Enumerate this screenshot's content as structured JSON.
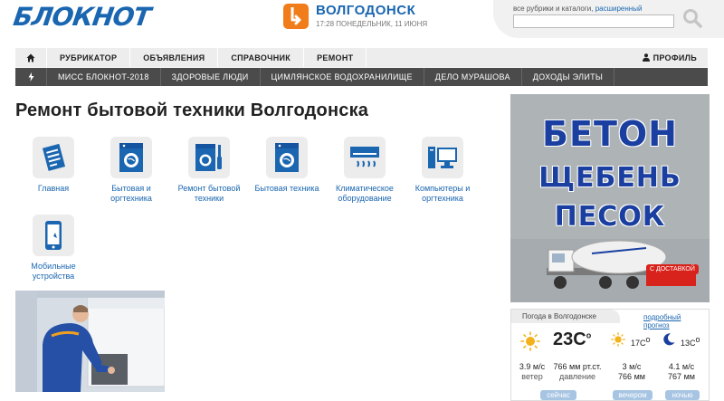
{
  "header": {
    "logo": "БЛОКНОТ",
    "city": "ВОЛГОДОНСК",
    "date": "17:28 ПОНЕДЕЛЬНИК, 11 ИЮНЯ",
    "search_hint": "все рубрики и каталоги,",
    "search_hint_link": "расширенный",
    "search_placeholder": ""
  },
  "menu_main": {
    "items": [
      "РУБРИКАТОР",
      "ОБЪЯВЛЕНИЯ",
      "СПРАВОЧНИК",
      "РЕМОНТ"
    ],
    "profile": "ПРОФИЛЬ"
  },
  "menu_hot": {
    "items": [
      "МИСС БЛОКНОТ-2018",
      "ЗДОРОВЫЕ ЛЮДИ",
      "ЦИМЛЯНСКОЕ ВОДОХРАНИЛИЩЕ",
      "ДЕЛО МУРАШОВА",
      "ДОХОДЫ ЭЛИТЫ"
    ]
  },
  "page": {
    "title": "Ремонт бытовой техники Волгодонска"
  },
  "rubrics": [
    {
      "label": "Главная",
      "icon": "document-icon"
    },
    {
      "label": "Бытовая и оргтехника",
      "icon": "washing-machine-icon"
    },
    {
      "label": "Ремонт бытовой техники",
      "icon": "repair-tools-icon"
    },
    {
      "label": "Бытовая техника",
      "icon": "washing-machine-icon"
    },
    {
      "label": "Климатическое оборудование",
      "icon": "air-conditioner-icon"
    },
    {
      "label": "Компьютеры и оргтехника",
      "icon": "computer-icon"
    },
    {
      "label": "Мобильные устройства",
      "icon": "mobile-phone-icon"
    }
  ],
  "ad": {
    "line1": "БЕТОН",
    "line2": "ЩЕБЕНЬ",
    "line3": "ПЕСОК",
    "badge": "С ДОСТАВКОЙ"
  },
  "weather": {
    "title": "Погода в Волгодонске",
    "link": "подробный прогноз",
    "now_temp": "23С",
    "evening_temp": "17С",
    "night_temp": "13С",
    "wind_now": "3.9 м/с",
    "wind_caption": "ветер",
    "pressure_now": "766 мм рт.ст.",
    "pressure_caption": "давление",
    "evening_wind": "3 м/с",
    "evening_pressure": "766 мм",
    "night_wind": "4.1 м/с",
    "night_pressure": "767 мм",
    "btn_now": "сейчас",
    "btn_evening": "вечером",
    "btn_night": "ночью"
  },
  "colors": {
    "brand_blue": "#1a66b0",
    "accent_orange": "#f07d1a",
    "menu_dark": "#4b4b4b"
  }
}
